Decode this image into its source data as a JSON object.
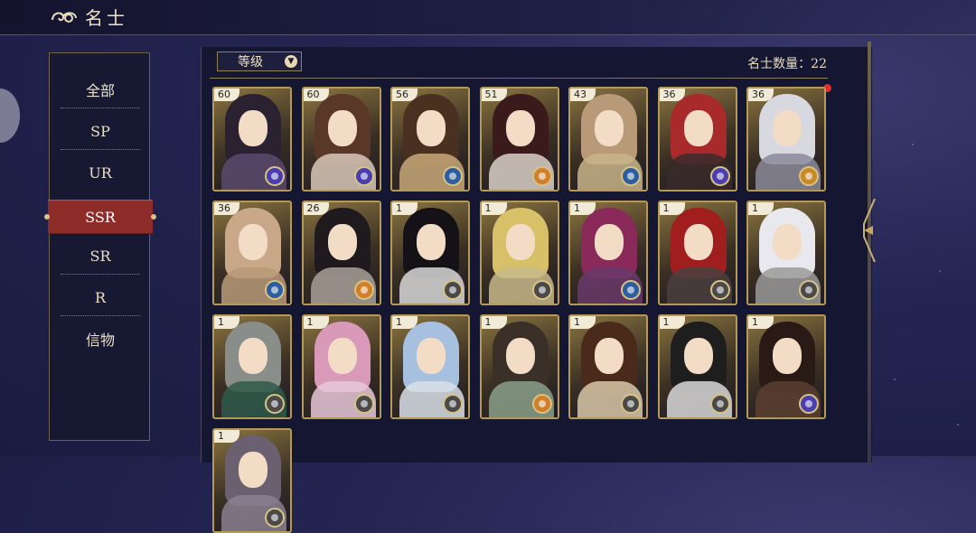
{
  "header": {
    "title": "名士"
  },
  "sidebar": {
    "items": [
      {
        "label": "全部"
      },
      {
        "label": "SP"
      },
      {
        "label": "UR"
      },
      {
        "label": "SSR",
        "active": true
      },
      {
        "label": "SR"
      },
      {
        "label": "R"
      },
      {
        "label": "信物"
      }
    ]
  },
  "toolbar": {
    "sort_label": "等级",
    "count_text": "名士数量：22"
  },
  "cards": [
    {
      "level": "60",
      "hair": "#2a2230",
      "robe": "#5a4a6e",
      "orb": "#4b3fb0"
    },
    {
      "level": "60",
      "hair": "#5a3828",
      "robe": "#d8c8b8",
      "orb": "#4b3fb0"
    },
    {
      "level": "56",
      "hair": "#4a3020",
      "robe": "#c8a878",
      "orb": "#2e5e9e"
    },
    {
      "level": "51",
      "hair": "#3a1a1a",
      "robe": "#d8d0c8",
      "orb": "#d0802a"
    },
    {
      "level": "43",
      "hair": "#b89a78",
      "robe": "#c8b48a",
      "orb": "#2e5e9e"
    },
    {
      "level": "36",
      "hair": "#a82a2a",
      "robe": "#3a2a2a",
      "orb": "#4b3fb0"
    },
    {
      "level": "36",
      "hair": "#d8d8e0",
      "robe": "#8a8a98",
      "orb": "#c88a28"
    },
    {
      "level": "36",
      "hair": "#c8a888",
      "robe": "#b89a78",
      "orb": "#2e5e9e"
    },
    {
      "level": "26",
      "hair": "#1e1a1e",
      "robe": "#a8a098",
      "orb": "#d0802a"
    },
    {
      "level": "1",
      "hair": "#141216",
      "robe": "#d8d8d8",
      "orb": "#4a4a4a"
    },
    {
      "level": "1",
      "hair": "#d8c068",
      "robe": "#c8b888",
      "orb": "#4a4a4a"
    },
    {
      "level": "1",
      "hair": "#8a2a5a",
      "robe": "#6a3a6a",
      "orb": "#2e5e9e"
    },
    {
      "level": "1",
      "hair": "#a01e1e",
      "robe": "#4a4040",
      "orb": "#4a4a4a"
    },
    {
      "level": "1",
      "hair": "#e8e8ee",
      "robe": "#9a9a9a",
      "orb": "#4a4a4a"
    },
    {
      "level": "1",
      "hair": "#8a8e8a",
      "robe": "#2e5a4a",
      "orb": "#4a4a4a"
    },
    {
      "level": "1",
      "hair": "#d89ab8",
      "robe": "#e8c8d8",
      "orb": "#4a4a4a"
    },
    {
      "level": "1",
      "hair": "#a8c0e0",
      "robe": "#d8e0e8",
      "orb": "#4a4a4a"
    },
    {
      "level": "1",
      "hair": "#3a3028",
      "robe": "#8aa088",
      "orb": "#d0802a"
    },
    {
      "level": "1",
      "hair": "#4a2a1a",
      "robe": "#d8c8a8",
      "orb": "#4a4a4a"
    },
    {
      "level": "1",
      "hair": "#1e1e1e",
      "robe": "#d8d8d8",
      "orb": "#4a4a4a"
    },
    {
      "level": "1",
      "hair": "#2a1a16",
      "robe": "#5a4030",
      "orb": "#4b3fb0"
    },
    {
      "level": "1",
      "hair": "#6a6070",
      "robe": "#8a8090",
      "orb": "#4a4a4a"
    }
  ]
}
